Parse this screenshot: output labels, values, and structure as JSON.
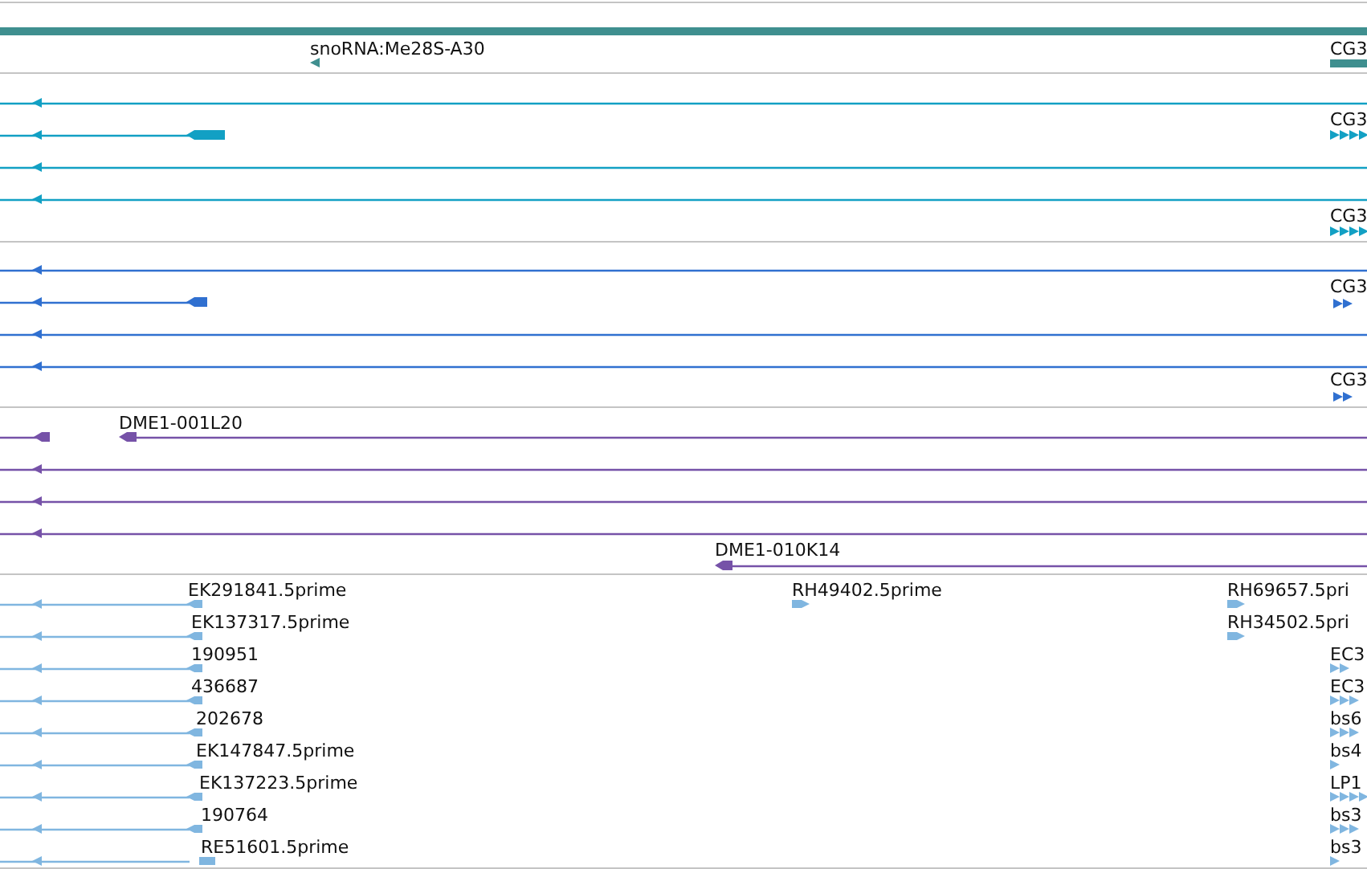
{
  "tracks": [
    {
      "color": "#3f8f8f",
      "features": [
        {
          "label": "snoRNA:Me28S-A30"
        },
        {
          "label": "CG3"
        }
      ]
    },
    {
      "color": "#12a0c4",
      "features": [
        {
          "label": "CG3"
        },
        {
          "label": "CG3"
        }
      ]
    },
    {
      "color": "#3070d0",
      "features": [
        {
          "label": "CG3"
        },
        {
          "label": "CG3"
        }
      ]
    },
    {
      "color": "#7652a8",
      "features": [
        {
          "label": "DME1-001L20"
        },
        {
          "label": "DME1-010K14"
        }
      ]
    },
    {
      "color": "#80b6e0",
      "features": [
        {
          "label": "EK291841.5prime"
        },
        {
          "label": "EK137317.5prime"
        },
        {
          "label": "190951"
        },
        {
          "label": "436687"
        },
        {
          "label": "202678"
        },
        {
          "label": "EK147847.5prime"
        },
        {
          "label": "EK137223.5prime"
        },
        {
          "label": "190764"
        },
        {
          "label": "RE51601.5prime"
        },
        {
          "label": "RH49402.5prime"
        },
        {
          "label": "RH69657.5pri"
        },
        {
          "label": "RH34502.5pri"
        },
        {
          "label": "EC3"
        },
        {
          "label": "EC3"
        },
        {
          "label": "bs6"
        },
        {
          "label": "bs4"
        },
        {
          "label": "LP1"
        },
        {
          "label": "bs3"
        },
        {
          "label": "bs3"
        }
      ]
    }
  ]
}
